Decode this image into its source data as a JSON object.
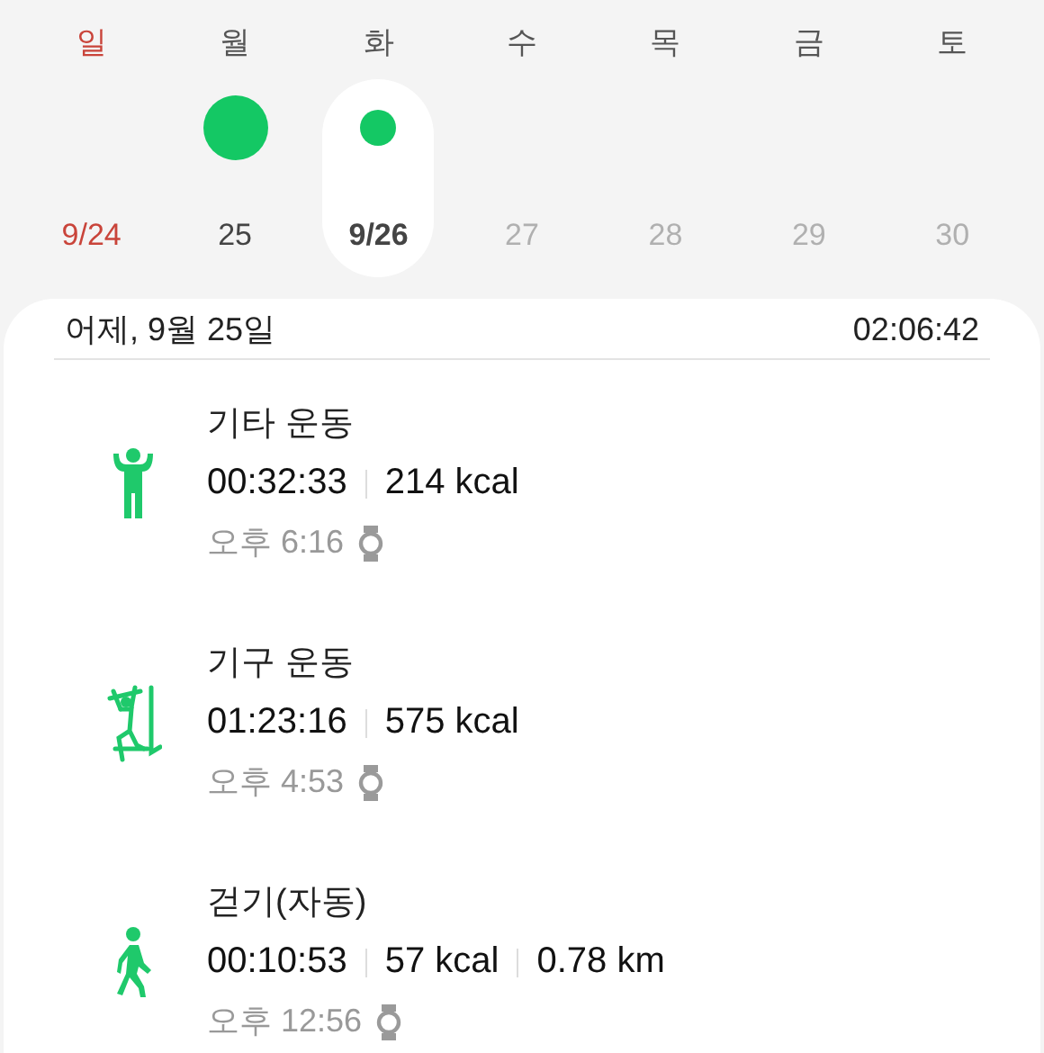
{
  "week": [
    {
      "weekday": "일",
      "date": "9/24",
      "kind": "sunday",
      "selected": false
    },
    {
      "weekday": "월",
      "date": "25",
      "kind": "past",
      "selected": false,
      "dot": {
        "kind": "large"
      }
    },
    {
      "weekday": "화",
      "date": "9/26",
      "kind": "past",
      "selected": true,
      "dot": {
        "kind": "small"
      }
    },
    {
      "weekday": "수",
      "date": "27",
      "kind": "future",
      "selected": false
    },
    {
      "weekday": "목",
      "date": "28",
      "kind": "future",
      "selected": false
    },
    {
      "weekday": "금",
      "date": "29",
      "kind": "future",
      "selected": false
    },
    {
      "weekday": "토",
      "date": "30",
      "kind": "future",
      "selected": false
    }
  ],
  "day": {
    "title": "어제, 9월 25일",
    "total": "02:06:42"
  },
  "activities": [
    {
      "kind": "other",
      "name": "기타 운동",
      "stats": [
        "00:32:33",
        "214 kcal"
      ],
      "time": "오후 6:16"
    },
    {
      "kind": "equipment",
      "name": "기구 운동",
      "stats": [
        "01:23:16",
        "575 kcal"
      ],
      "time": "오후 4:53"
    },
    {
      "kind": "walking",
      "name": "걷기(자동)",
      "stats": [
        "00:10:53",
        "57 kcal",
        "0.78 km"
      ],
      "time": "오후 12:56"
    }
  ]
}
